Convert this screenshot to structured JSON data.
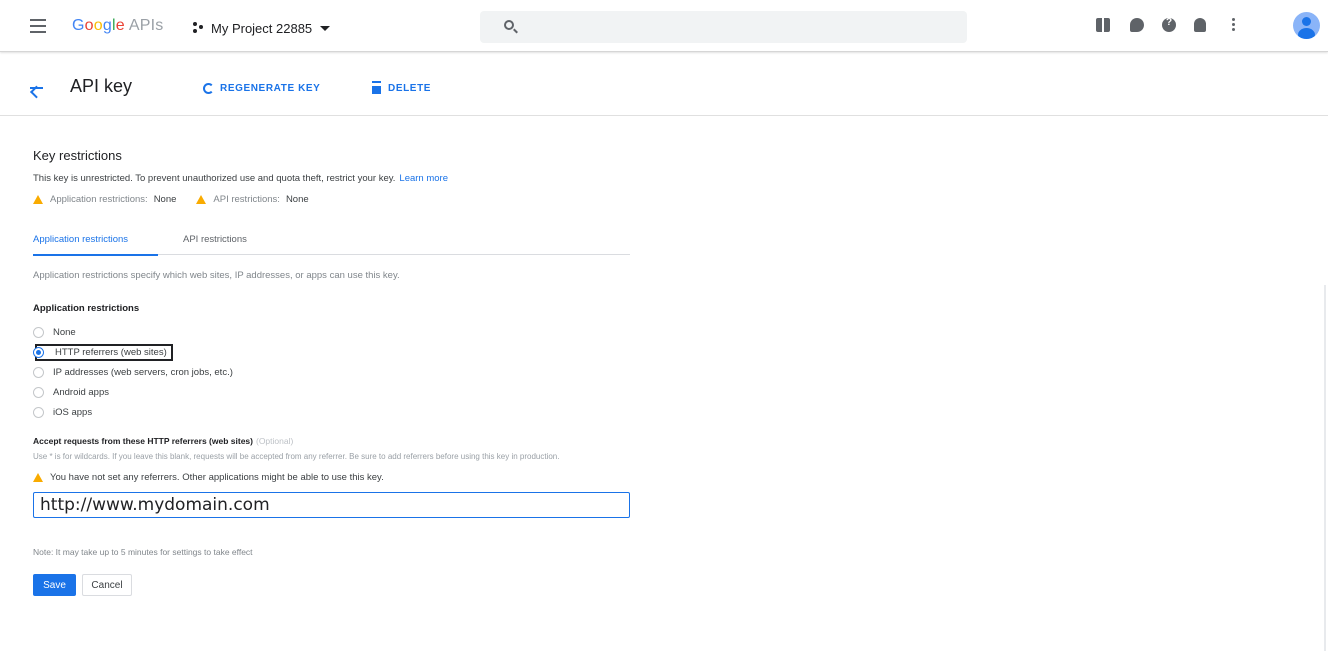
{
  "header": {
    "logo_google": [
      "G",
      "o",
      "o",
      "g",
      "l",
      "e"
    ],
    "logo_suffix": "APIs",
    "project_name": "My Project 22885"
  },
  "toolbar_icons": [
    "hamburger-menu-icon",
    "search-icon",
    "gift-icon",
    "chat-icon",
    "help-icon",
    "bell-icon",
    "more-vert-icon",
    "account-avatar"
  ],
  "action_bar": {
    "title": "API key",
    "regenerate_label": "REGENERATE KEY",
    "delete_label": "DELETE"
  },
  "key_restrictions": {
    "title": "Key restrictions",
    "description": "This key is unrestricted. To prevent unauthorized use and quota theft, restrict your key.",
    "learn_more": "Learn more",
    "app_restrictions_label": "Application restrictions:",
    "app_restrictions_value": "None",
    "api_restrictions_label": "API restrictions:",
    "api_restrictions_value": "None"
  },
  "tabs": [
    "Application restrictions",
    "API restrictions"
  ],
  "application": {
    "description": "Application restrictions specify which web sites, IP addresses, or apps can use this key.",
    "group_title": "Application restrictions",
    "options": [
      {
        "label": "None",
        "selected": false
      },
      {
        "label": "HTTP referrers (web sites)",
        "selected": true
      },
      {
        "label": "IP addresses (web servers, cron jobs, etc.)",
        "selected": false
      },
      {
        "label": "Android apps",
        "selected": false
      },
      {
        "label": "iOS apps",
        "selected": false
      }
    ],
    "accept_title": "Accept requests from these HTTP referrers (web sites)",
    "optional": "(Optional)",
    "help_text": "Use * is for wildcards. If you leave this blank, requests will be accepted from any referrer. Be sure to add referrers before using this key in production.",
    "warning": "You have not set any referrers. Other applications might be able to use this key.",
    "referrer_value": "http://www.mydomain.com",
    "note": "Note: It may take up to 5 minutes for settings to take effect",
    "save_label": "Save",
    "cancel_label": "Cancel"
  }
}
